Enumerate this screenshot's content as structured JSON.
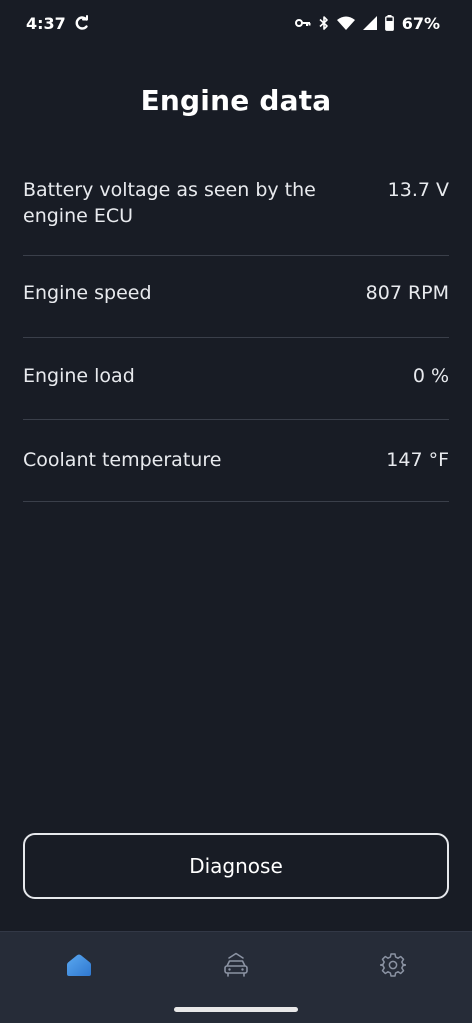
{
  "status_bar": {
    "time": "4:37",
    "battery_percent": "67%",
    "icons": [
      "sync-icon",
      "vpn-key-icon",
      "bluetooth-icon",
      "wifi-icon",
      "cell-signal-icon",
      "battery-icon"
    ]
  },
  "page": {
    "title": "Engine data"
  },
  "engine_data": [
    {
      "label": "Battery voltage as seen by the engine ECU",
      "value": "13.7 V"
    },
    {
      "label": "Engine speed",
      "value": "807 RPM"
    },
    {
      "label": "Engine load",
      "value": "0 %"
    },
    {
      "label": "Coolant temperature",
      "value": "147 °F"
    }
  ],
  "actions": {
    "diagnose_label": "Diagnose"
  },
  "bottom_nav": {
    "items": [
      {
        "icon": "home-icon",
        "active": true
      },
      {
        "icon": "car-icon",
        "active": false
      },
      {
        "icon": "gear-icon",
        "active": false
      }
    ]
  },
  "colors": {
    "background": "#181c25",
    "nav_background": "#262c38",
    "divider": "#3a3f4a",
    "accent": "#3d8fe0",
    "inactive_icon": "#8b93a3"
  }
}
